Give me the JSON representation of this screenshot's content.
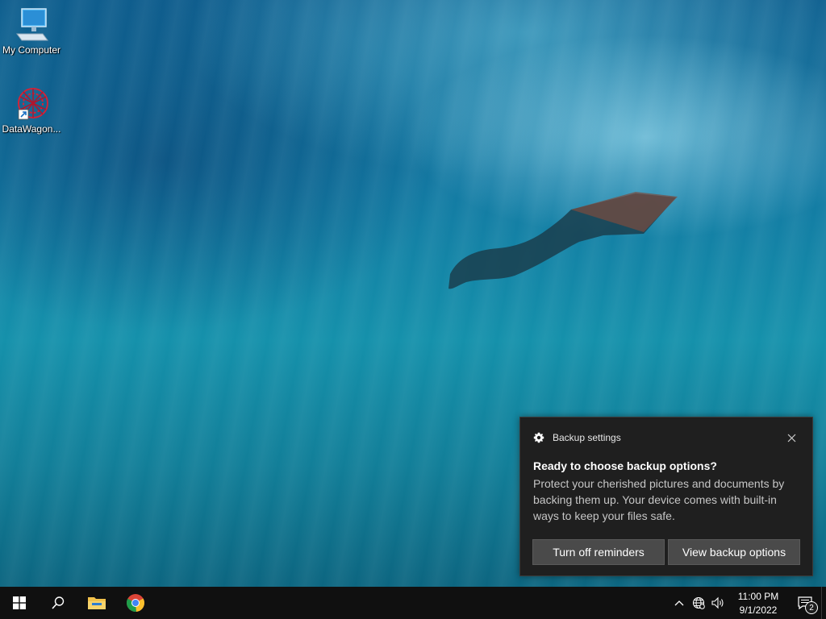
{
  "desktop": {
    "icons": [
      {
        "label": "My Computer",
        "icon": "computer-icon"
      },
      {
        "label": "DataWagon...",
        "icon": "datawagon-app-icon"
      }
    ]
  },
  "toast": {
    "app_name": "Backup settings",
    "app_icon": "gear-icon",
    "title": "Ready to choose backup options?",
    "body": "Protect your cherished pictures and documents by backing them up. Your device comes with built-in ways to keep your files safe.",
    "buttons": {
      "turn_off": "Turn off reminders",
      "view": "View backup options"
    }
  },
  "taskbar": {
    "pinned": [
      {
        "name": "start",
        "icon": "windows-icon"
      },
      {
        "name": "search",
        "icon": "search-icon"
      },
      {
        "name": "file-explorer",
        "icon": "folder-icon"
      },
      {
        "name": "chrome",
        "icon": "chrome-icon"
      }
    ],
    "tray": {
      "time": "11:00 PM",
      "date": "9/1/2022",
      "notification_count": "2"
    }
  },
  "colors": {
    "toast_bg": "#1f1f1f",
    "button_bg": "#4a4a4a",
    "taskbar_bg": "#101010",
    "accent": "#0078d7"
  }
}
